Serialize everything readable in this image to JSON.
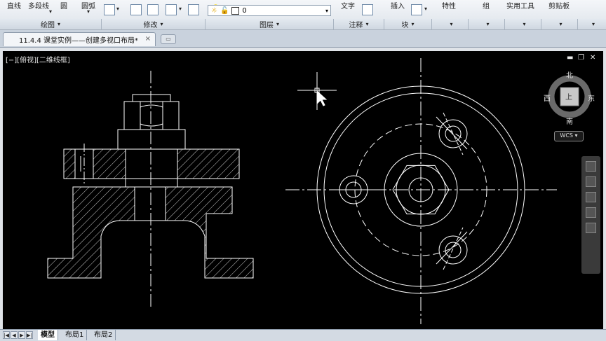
{
  "ribbon": {
    "top_labels": {
      "line": "直线",
      "polyline": "多段线",
      "circle": "圆",
      "arc": "圆弧",
      "text": "文字",
      "insert": "插入",
      "properties": "特性",
      "group": "组",
      "utilities": "实用工具",
      "clipboard": "剪贴板"
    },
    "groups": {
      "draw": "绘图",
      "modify": "修改",
      "layers": "图层",
      "annotation": "注释",
      "block": "块"
    },
    "layer_value": "0"
  },
  "tab": {
    "title": "11.4.4 课堂实例——创建多视口布局*",
    "close": "×"
  },
  "viewport": {
    "label": "[−][俯视][二维线框]",
    "ctrl_min": "▬",
    "ctrl_restore": "❐",
    "ctrl_close": "✕"
  },
  "viewcube": {
    "north": "北",
    "south": "南",
    "east": "东",
    "west": "西",
    "face": "上",
    "wcs": "WCS"
  },
  "layout_tabs": [
    "模型",
    "布局1",
    "布局2"
  ],
  "colors": {
    "canvas_bg": "#000000",
    "drawing_line": "#ffffff"
  }
}
